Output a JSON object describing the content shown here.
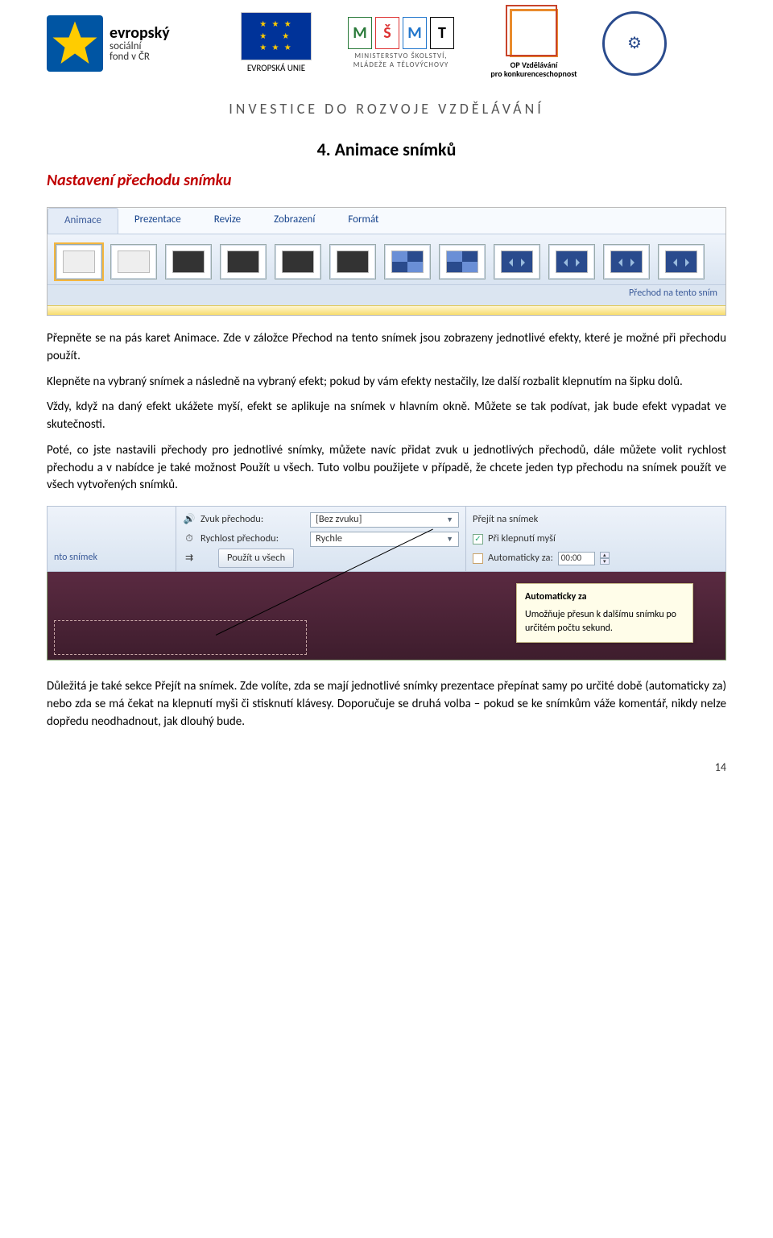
{
  "header": {
    "esf_brand_main": "evropský",
    "esf_brand_sub1": "sociální",
    "esf_brand_sub2": "fond v ČR",
    "eu_label": "EVROPSKÁ UNIE",
    "msmt_line1": "MINISTERSTVO ŠKOLSTVÍ,",
    "msmt_line2": "MLÁDEŽE A TĚLOVÝCHOVY",
    "op_line1": "OP Vzdělávání",
    "op_line2": "pro konkurenceschopnost",
    "invest": "INVESTICE DO ROZVOJE VZDĚLÁVÁNÍ"
  },
  "title": "4. Animace snímků",
  "subtitle": "Nastavení přechodu snímku",
  "ribbon1": {
    "tabs": [
      "Animace",
      "Prezentace",
      "Revize",
      "Zobrazení",
      "Formát"
    ],
    "caption": "Přechod na tento sním"
  },
  "para1": "Přepněte se na pás karet Animace. Zde v záložce Přechod na tento snímek jsou zobrazeny jednotlivé efekty, které je možné při přechodu použít.",
  "para2": "Klepněte na vybraný snímek a následně na vybraný efekt; pokud by vám efekty nestačily, lze další rozbalit klepnutím na šipku dolů.",
  "para3": "Vždy, když na daný efekt ukážete myší, efekt se aplikuje na snímek v hlavním okně. Můžete se tak podívat, jak bude efekt vypadat ve skutečnosti.",
  "para4": "Poté, co jste nastavili přechody pro jednotlivé snímky, můžete navíc přidat zvuk u jednotlivých přechodů, dále můžete volit rychlost přechodu a v nabídce je také možnost Použít u všech. Tuto volbu použijete v případě, že chcete jeden typ přechodu na snímek použít ve všech vytvořených snímků.",
  "ribbon2": {
    "left_label": "nto snímek",
    "sound_label": "Zvuk přechodu:",
    "sound_value": "[Bez zvuku]",
    "speed_label": "Rychlost přechodu:",
    "speed_value": "Rychle",
    "apply_all": "Použít u všech",
    "right_header": "Přejít na snímek",
    "opt_click": "Při klepnutí myší",
    "opt_auto": "Automaticky za:",
    "auto_time": "00:00"
  },
  "tooltip": {
    "title": "Automaticky za",
    "body": "Umožňuje přesun k dalšímu snímku po určitém počtu sekund."
  },
  "para5": "Důležitá je také sekce Přejít na snímek. Zde volíte, zda se mají jednotlivé snímky prezentace přepínat samy po určité době (automaticky za) nebo zda se má čekat na klepnutí myši či stisknutí klávesy. Doporučuje se druhá volba – pokud se ke snímkům váže komentář, nikdy nelze dopředu neodhadnout, jak dlouhý bude.",
  "page_number": "14"
}
